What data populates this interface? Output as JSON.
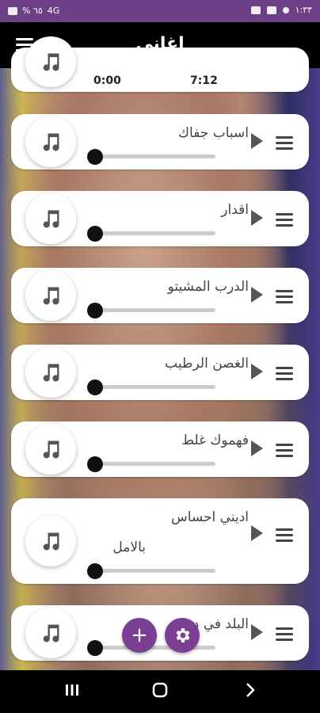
{
  "status_bar": {
    "left_text": "% ٦٥",
    "network_label": "4G",
    "time": "١:٣٣"
  },
  "app_bar": {
    "title": "اغاني",
    "menu_icon": "menu-icon"
  },
  "now_playing": {
    "current_time": "0:00",
    "duration": "7:12"
  },
  "songs": [
    {
      "title": "اسباب جفاك",
      "progress": 0
    },
    {
      "title": "اقدار",
      "progress": 0
    },
    {
      "title": "الدرب المشيتو",
      "progress": 0
    },
    {
      "title": "الغصن الرطيب",
      "progress": 0
    },
    {
      "title": "فهموك غلط",
      "progress": 0
    },
    {
      "title_line1": "اديني احساس",
      "title_line2": "بالامل",
      "progress": 0
    },
    {
      "title": "البلد في دنيا",
      "progress": 0
    }
  ],
  "fab": {
    "add_icon": "plus-icon",
    "settings_icon": "gear-icon",
    "add_symbol": "+"
  },
  "colors": {
    "primary": "#6d3f86",
    "accent": "#7a3f93",
    "card": "#ffffff"
  }
}
